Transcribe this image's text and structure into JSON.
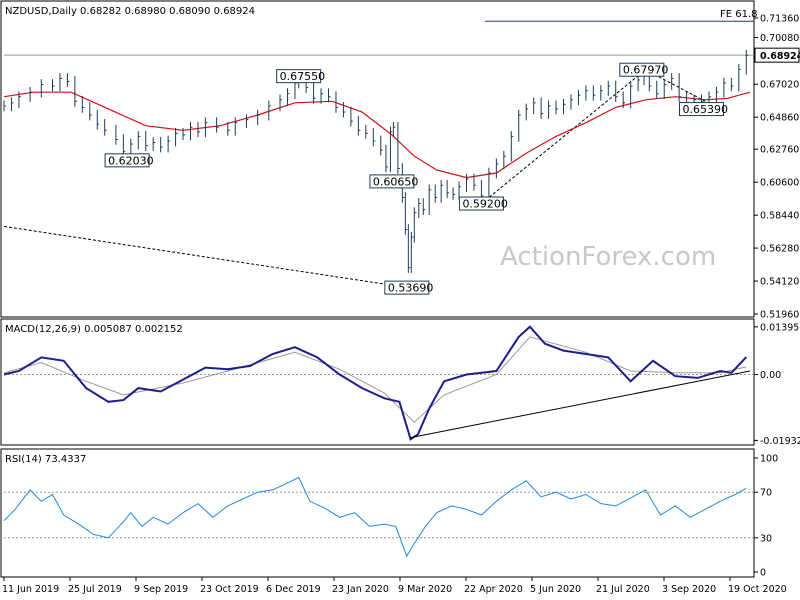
{
  "chart_data": {
    "type": "line",
    "symbol_header": "NZDUSD,Daily  0.68282 0.68980 0.68090 0.68924",
    "watermark": "ActionForex.com",
    "x_tick_labels": [
      "11 Jun 2019",
      "25 Jul 2019",
      "9 Sep 2019",
      "23 Oct 2019",
      "6 Dec 2019",
      "23 Jan 2020",
      "9 Mar 2020",
      "22 Apr 2020",
      "5 Jun 2020",
      "21 Jul 2020",
      "3 Sep 2020",
      "19 Oct 2020"
    ],
    "price_panel": {
      "y_ticks": [
        "0.71360",
        "0.70080",
        "0.67020",
        "0.64860",
        "0.62760",
        "0.60600",
        "0.58440",
        "0.56280",
        "0.54120",
        "0.51960"
      ],
      "ylim": [
        0.5196,
        0.7136
      ],
      "last_price": "0.68924",
      "fe_label": "FE 61.8",
      "fe_level": 0.7115,
      "annotations": [
        {
          "text": "0.67550",
          "t": 0.395,
          "price": 0.6755
        },
        {
          "text": "0.62030",
          "t": 0.165,
          "price": 0.6203
        },
        {
          "text": "0.60650",
          "t": 0.52,
          "price": 0.6065
        },
        {
          "text": "0.59200",
          "t": 0.64,
          "price": 0.592
        },
        {
          "text": "0.53690",
          "t": 0.54,
          "price": 0.5369
        },
        {
          "text": "0.67970",
          "t": 0.855,
          "price": 0.6797
        },
        {
          "text": "0.65390",
          "t": 0.935,
          "price": 0.6539
        }
      ],
      "close_series": [
        [
          0.0,
          0.656
        ],
        [
          0.01,
          0.658
        ],
        [
          0.02,
          0.662
        ],
        [
          0.035,
          0.665
        ],
        [
          0.05,
          0.67
        ],
        [
          0.065,
          0.669
        ],
        [
          0.075,
          0.674
        ],
        [
          0.085,
          0.672
        ],
        [
          0.095,
          0.659
        ],
        [
          0.105,
          0.655
        ],
        [
          0.115,
          0.65
        ],
        [
          0.125,
          0.644
        ],
        [
          0.135,
          0.64
        ],
        [
          0.15,
          0.634
        ],
        [
          0.16,
          0.626
        ],
        [
          0.17,
          0.631
        ],
        [
          0.18,
          0.636
        ],
        [
          0.19,
          0.63
        ],
        [
          0.2,
          0.632
        ],
        [
          0.21,
          0.629
        ],
        [
          0.22,
          0.633
        ],
        [
          0.23,
          0.638
        ],
        [
          0.24,
          0.637
        ],
        [
          0.25,
          0.642
        ],
        [
          0.26,
          0.639
        ],
        [
          0.27,
          0.645
        ],
        [
          0.285,
          0.642
        ],
        [
          0.3,
          0.64
        ],
        [
          0.31,
          0.645
        ],
        [
          0.325,
          0.647
        ],
        [
          0.34,
          0.65
        ],
        [
          0.355,
          0.656
        ],
        [
          0.37,
          0.66
        ],
        [
          0.38,
          0.664
        ],
        [
          0.39,
          0.671
        ],
        [
          0.395,
          0.674
        ],
        [
          0.405,
          0.668
        ],
        [
          0.415,
          0.661
        ],
        [
          0.425,
          0.664
        ],
        [
          0.435,
          0.662
        ],
        [
          0.445,
          0.655
        ],
        [
          0.455,
          0.652
        ],
        [
          0.465,
          0.646
        ],
        [
          0.475,
          0.64
        ],
        [
          0.485,
          0.638
        ],
        [
          0.495,
          0.633
        ],
        [
          0.505,
          0.627
        ],
        [
          0.512,
          0.616
        ],
        [
          0.518,
          0.639
        ],
        [
          0.522,
          0.642
        ],
        [
          0.528,
          0.615
        ],
        [
          0.534,
          0.596
        ],
        [
          0.538,
          0.575
        ],
        [
          0.542,
          0.55
        ],
        [
          0.546,
          0.57
        ],
        [
          0.55,
          0.586
        ],
        [
          0.556,
          0.592
        ],
        [
          0.562,
          0.588
        ],
        [
          0.57,
          0.601
        ],
        [
          0.578,
          0.596
        ],
        [
          0.586,
          0.604
        ],
        [
          0.594,
          0.599
        ],
        [
          0.602,
          0.598
        ],
        [
          0.61,
          0.603
        ],
        [
          0.62,
          0.608
        ],
        [
          0.63,
          0.604
        ],
        [
          0.64,
          0.597
        ],
        [
          0.65,
          0.612
        ],
        [
          0.66,
          0.618
        ],
        [
          0.67,
          0.623
        ],
        [
          0.68,
          0.636
        ],
        [
          0.69,
          0.65
        ],
        [
          0.7,
          0.654
        ],
        [
          0.71,
          0.658
        ],
        [
          0.72,
          0.651
        ],
        [
          0.73,
          0.656
        ],
        [
          0.74,
          0.654
        ],
        [
          0.75,
          0.657
        ],
        [
          0.76,
          0.66
        ],
        [
          0.77,
          0.663
        ],
        [
          0.78,
          0.666
        ],
        [
          0.79,
          0.663
        ],
        [
          0.8,
          0.666
        ],
        [
          0.81,
          0.669
        ],
        [
          0.82,
          0.662
        ],
        [
          0.83,
          0.658
        ],
        [
          0.84,
          0.669
        ],
        [
          0.85,
          0.673
        ],
        [
          0.858,
          0.677
        ],
        [
          0.865,
          0.669
        ],
        [
          0.875,
          0.664
        ],
        [
          0.885,
          0.67
        ],
        [
          0.895,
          0.674
        ],
        [
          0.905,
          0.662
        ],
        [
          0.915,
          0.656
        ],
        [
          0.925,
          0.66
        ],
        [
          0.935,
          0.659
        ],
        [
          0.945,
          0.662
        ],
        [
          0.955,
          0.665
        ],
        [
          0.965,
          0.671
        ],
        [
          0.975,
          0.669
        ],
        [
          0.985,
          0.68
        ],
        [
          0.995,
          0.6892
        ]
      ],
      "ma_series": [
        [
          0.0,
          0.662
        ],
        [
          0.04,
          0.665
        ],
        [
          0.09,
          0.665
        ],
        [
          0.14,
          0.654
        ],
        [
          0.19,
          0.643
        ],
        [
          0.24,
          0.64
        ],
        [
          0.29,
          0.643
        ],
        [
          0.34,
          0.65
        ],
        [
          0.39,
          0.658
        ],
        [
          0.44,
          0.659
        ],
        [
          0.48,
          0.652
        ],
        [
          0.52,
          0.637
        ],
        [
          0.55,
          0.623
        ],
        [
          0.58,
          0.614
        ],
        [
          0.62,
          0.609
        ],
        [
          0.66,
          0.612
        ],
        [
          0.7,
          0.625
        ],
        [
          0.74,
          0.636
        ],
        [
          0.78,
          0.645
        ],
        [
          0.82,
          0.655
        ],
        [
          0.86,
          0.66
        ],
        [
          0.9,
          0.662
        ],
        [
          0.94,
          0.66
        ],
        [
          0.97,
          0.661
        ],
        [
          1.0,
          0.665
        ]
      ]
    },
    "macd_panel": {
      "label": "MACD(12,26,9) 0.005087 0.002152",
      "y_ticks": [
        "0.013956",
        "0.00",
        "-0.019325"
      ],
      "ylim": [
        -0.0195,
        0.0142
      ],
      "series": [
        [
          0.0,
          0.0
        ],
        [
          0.02,
          0.001
        ],
        [
          0.05,
          0.005
        ],
        [
          0.08,
          0.004
        ],
        [
          0.11,
          -0.004
        ],
        [
          0.14,
          -0.008
        ],
        [
          0.16,
          -0.0075
        ],
        [
          0.18,
          -0.004
        ],
        [
          0.21,
          -0.005
        ],
        [
          0.24,
          -0.0015
        ],
        [
          0.27,
          0.002
        ],
        [
          0.3,
          0.0015
        ],
        [
          0.33,
          0.0025
        ],
        [
          0.36,
          0.006
        ],
        [
          0.39,
          0.008
        ],
        [
          0.42,
          0.005
        ],
        [
          0.45,
          0.0
        ],
        [
          0.48,
          -0.004
        ],
        [
          0.51,
          -0.007
        ],
        [
          0.53,
          -0.008
        ],
        [
          0.545,
          -0.019
        ],
        [
          0.555,
          -0.0175
        ],
        [
          0.57,
          -0.01
        ],
        [
          0.59,
          -0.002
        ],
        [
          0.62,
          0.0
        ],
        [
          0.66,
          0.001
        ],
        [
          0.69,
          0.011
        ],
        [
          0.705,
          0.014
        ],
        [
          0.725,
          0.009
        ],
        [
          0.75,
          0.007
        ],
        [
          0.78,
          0.006
        ],
        [
          0.81,
          0.005
        ],
        [
          0.84,
          -0.002
        ],
        [
          0.87,
          0.004
        ],
        [
          0.9,
          -0.0005
        ],
        [
          0.93,
          -0.001
        ],
        [
          0.96,
          0.001
        ],
        [
          0.975,
          0.0005
        ],
        [
          0.995,
          0.0051
        ]
      ],
      "signal": [
        [
          0.0,
          0.0005
        ],
        [
          0.05,
          0.0035
        ],
        [
          0.11,
          -0.002
        ],
        [
          0.16,
          -0.006
        ],
        [
          0.24,
          -0.0025
        ],
        [
          0.3,
          0.001
        ],
        [
          0.39,
          0.0065
        ],
        [
          0.45,
          0.0015
        ],
        [
          0.51,
          -0.0055
        ],
        [
          0.55,
          -0.014
        ],
        [
          0.59,
          -0.006
        ],
        [
          0.66,
          0.0
        ],
        [
          0.705,
          0.011
        ],
        [
          0.78,
          0.0065
        ],
        [
          0.84,
          0.001
        ],
        [
          0.9,
          0.0005
        ],
        [
          0.96,
          0.0005
        ],
        [
          0.995,
          0.0022
        ]
      ],
      "trendline": [
        [
          0.545,
          -0.0185
        ],
        [
          1.0,
          0.001
        ]
      ]
    },
    "rsi_panel": {
      "label": "RSI(14) 73.4337",
      "y_ticks": [
        "100",
        "70",
        "30",
        "0"
      ],
      "ylim": [
        0,
        100
      ],
      "levels": [
        70,
        30
      ],
      "series": [
        [
          0.0,
          45
        ],
        [
          0.015,
          55
        ],
        [
          0.035,
          72
        ],
        [
          0.05,
          62
        ],
        [
          0.065,
          68
        ],
        [
          0.08,
          50
        ],
        [
          0.1,
          42
        ],
        [
          0.12,
          33
        ],
        [
          0.14,
          30
        ],
        [
          0.16,
          44
        ],
        [
          0.17,
          52
        ],
        [
          0.185,
          40
        ],
        [
          0.2,
          48
        ],
        [
          0.22,
          42
        ],
        [
          0.24,
          52
        ],
        [
          0.26,
          60
        ],
        [
          0.28,
          48
        ],
        [
          0.3,
          58
        ],
        [
          0.32,
          64
        ],
        [
          0.34,
          70
        ],
        [
          0.36,
          72
        ],
        [
          0.38,
          78
        ],
        [
          0.395,
          83
        ],
        [
          0.41,
          62
        ],
        [
          0.43,
          56
        ],
        [
          0.45,
          48
        ],
        [
          0.47,
          52
        ],
        [
          0.49,
          40
        ],
        [
          0.51,
          42
        ],
        [
          0.525,
          40
        ],
        [
          0.54,
          14
        ],
        [
          0.55,
          25
        ],
        [
          0.565,
          40
        ],
        [
          0.58,
          52
        ],
        [
          0.6,
          58
        ],
        [
          0.62,
          55
        ],
        [
          0.64,
          50
        ],
        [
          0.66,
          62
        ],
        [
          0.68,
          72
        ],
        [
          0.7,
          80
        ],
        [
          0.72,
          66
        ],
        [
          0.74,
          70
        ],
        [
          0.76,
          64
        ],
        [
          0.78,
          68
        ],
        [
          0.8,
          60
        ],
        [
          0.82,
          58
        ],
        [
          0.84,
          65
        ],
        [
          0.86,
          72
        ],
        [
          0.88,
          50
        ],
        [
          0.9,
          58
        ],
        [
          0.92,
          48
        ],
        [
          0.94,
          55
        ],
        [
          0.96,
          62
        ],
        [
          0.98,
          68
        ],
        [
          0.995,
          73.4
        ]
      ]
    }
  }
}
